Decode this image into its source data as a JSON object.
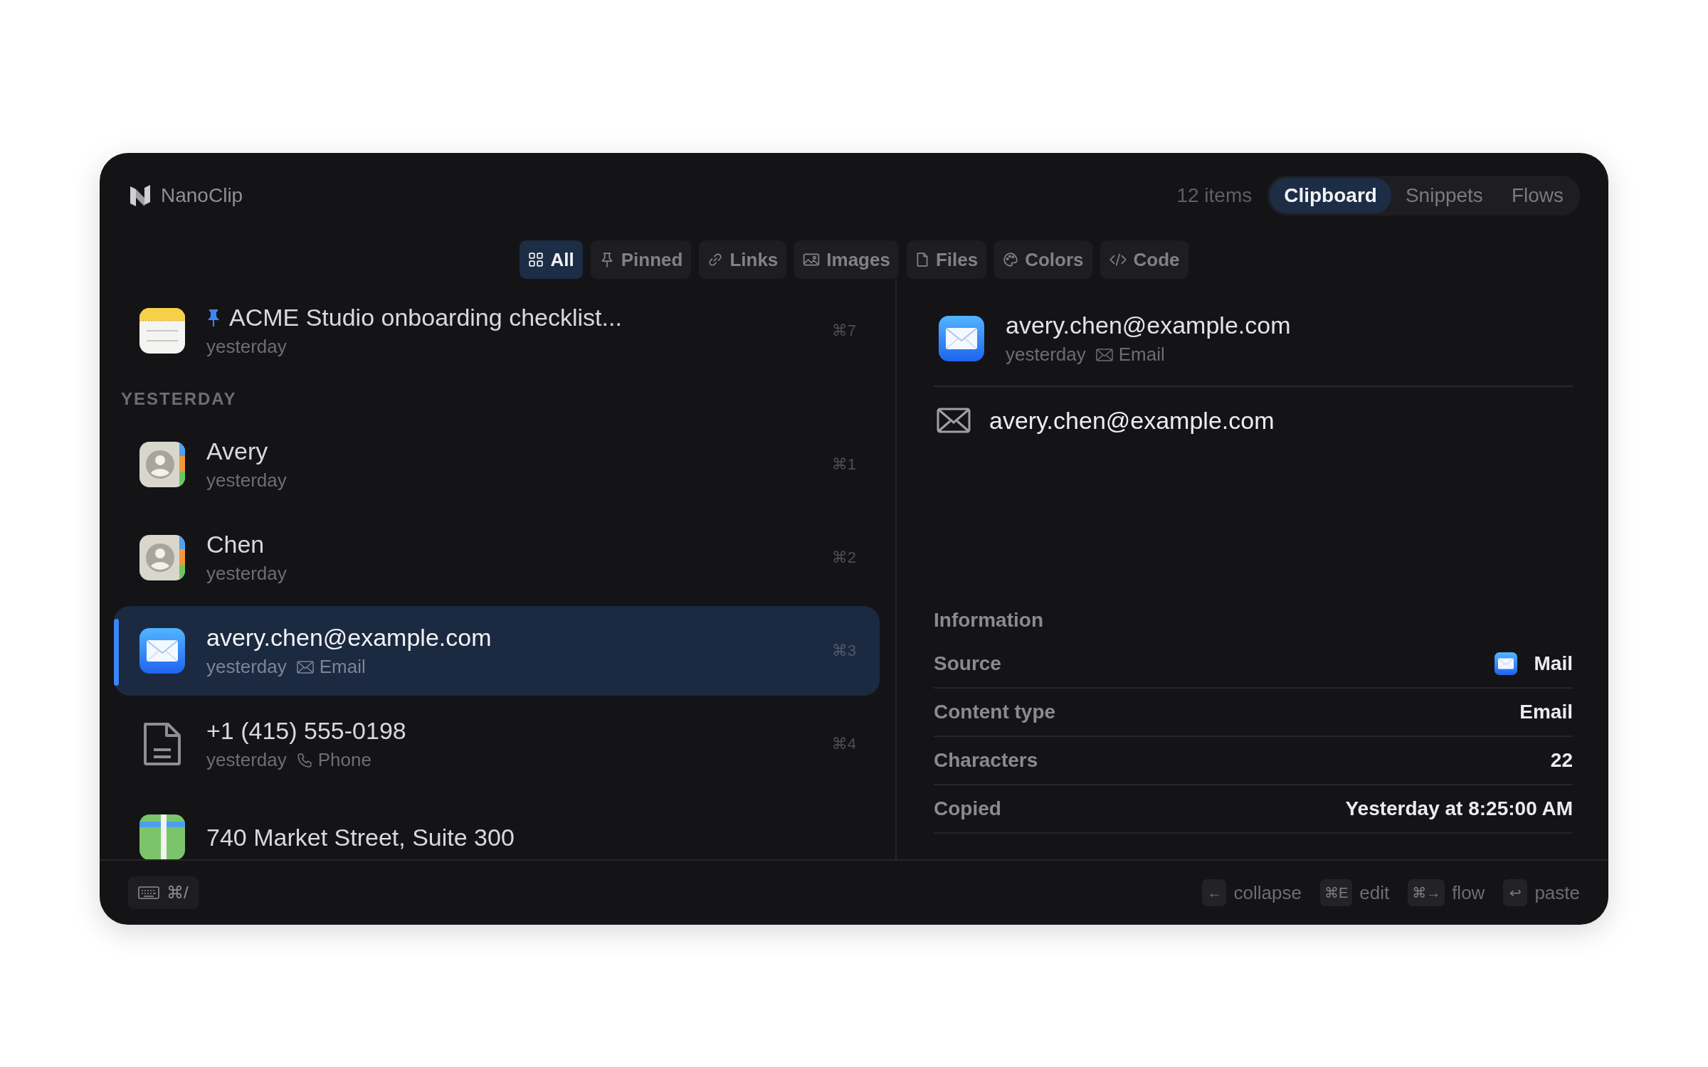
{
  "app": {
    "name": "NanoClip"
  },
  "item_count": "12 items",
  "modes": [
    {
      "label": "Clipboard",
      "selected": true
    },
    {
      "label": "Snippets",
      "selected": false
    },
    {
      "label": "Flows",
      "selected": false
    }
  ],
  "filters": [
    {
      "kind": "all",
      "label": "All",
      "selected": true
    },
    {
      "kind": "pinned",
      "label": "Pinned",
      "selected": false
    },
    {
      "kind": "links",
      "label": "Links",
      "selected": false
    },
    {
      "kind": "images",
      "label": "Images",
      "selected": false
    },
    {
      "kind": "files",
      "label": "Files",
      "selected": false
    },
    {
      "kind": "colors",
      "label": "Colors",
      "selected": false
    },
    {
      "kind": "code",
      "label": "Code",
      "selected": false
    }
  ],
  "pinned": [
    {
      "kind": "notes",
      "title": "ACME Studio onboarding checklist...",
      "time": "yesterday",
      "shortcut": "⌘7",
      "pinned": true,
      "selected": false
    }
  ],
  "section": "YESTERDAY",
  "items": [
    {
      "kind": "contact",
      "title": "Avery",
      "time": "yesterday",
      "shortcut": "⌘1",
      "selected": false
    },
    {
      "kind": "contact",
      "title": "Chen",
      "time": "yesterday",
      "shortcut": "⌘2",
      "selected": false
    },
    {
      "kind": "mail",
      "title": "avery.chen@example.com",
      "time": "yesterday",
      "type": {
        "kind": "envelope",
        "label": "Email"
      },
      "shortcut": "⌘3",
      "selected": true
    },
    {
      "kind": "document",
      "title": "+1 (415) 555-0198",
      "time": "yesterday",
      "type": {
        "kind": "phone",
        "label": "Phone"
      },
      "shortcut": "⌘4",
      "selected": false
    },
    {
      "kind": "map",
      "title": "740 Market Street, Suite 300",
      "selected": false
    }
  ],
  "detail": {
    "kind": "mail",
    "title": "avery.chen@example.com",
    "time": "yesterday",
    "type": {
      "kind": "envelope",
      "label": "Email"
    },
    "content": {
      "kind": "envelope",
      "text": "avery.chen@example.com"
    },
    "info_heading": "Information",
    "info": [
      {
        "kind": "app",
        "label": "Source",
        "value": "Mail"
      },
      {
        "kind": "text",
        "label": "Content type",
        "value": "Email"
      },
      {
        "kind": "text",
        "label": "Characters",
        "value": "22"
      },
      {
        "kind": "text",
        "label": "Copied",
        "value": "Yesterday at 8:25:00 AM"
      }
    ]
  },
  "footer": {
    "help_key": "⌘/",
    "actions": [
      {
        "key": "←",
        "label": "collapse"
      },
      {
        "key": "⌘E",
        "label": "edit"
      },
      {
        "key": "⌘→",
        "label": "flow"
      },
      {
        "key": "↩",
        "label": "paste"
      }
    ]
  }
}
